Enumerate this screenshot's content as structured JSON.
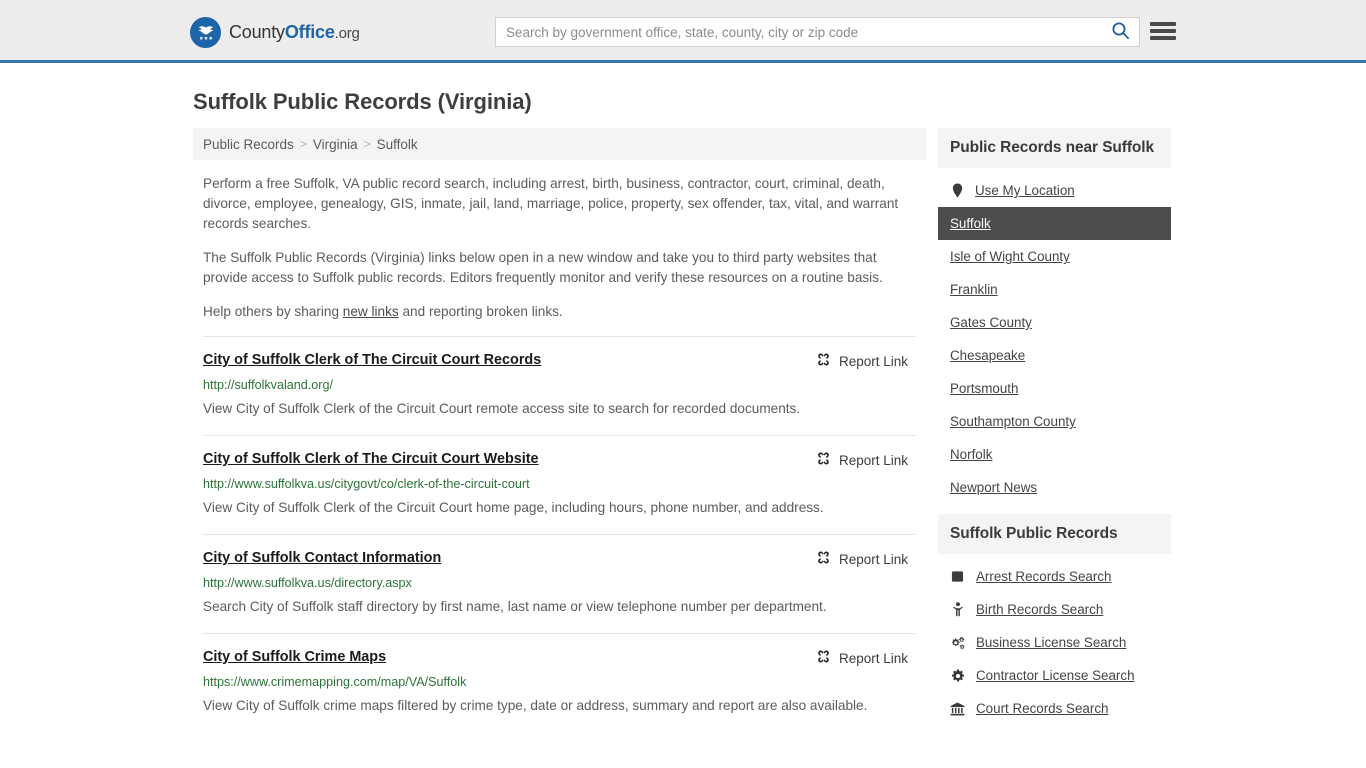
{
  "header": {
    "brand": {
      "part1": "County",
      "part2": "Office",
      "part3": ".org",
      "logo_icon": "eagle-shield-logo"
    },
    "search": {
      "placeholder": "Search by government office, state, county, city or zip code",
      "value": ""
    },
    "search_icon": "search-icon",
    "menu_icon": "hamburger-menu-icon"
  },
  "page": {
    "title": "Suffolk Public Records (Virginia)"
  },
  "breadcrumb": {
    "items": [
      {
        "label": "Public Records",
        "current": false
      },
      {
        "label": "Virginia",
        "current": false
      },
      {
        "label": "Suffolk",
        "current": true
      }
    ],
    "separator": ">"
  },
  "intro": {
    "p1": "Perform a free Suffolk, VA public record search, including arrest, birth, business, contractor, court, criminal, death, divorce, employee, genealogy, GIS, inmate, jail, land, marriage, police, property, sex offender, tax, vital, and warrant records searches.",
    "p2": "The Suffolk Public Records (Virginia) links below open in a new window and take you to third party websites that provide access to Suffolk public records. Editors frequently monitor and verify these resources on a routine basis.",
    "p3_before": "Help others by sharing ",
    "p3_link": "new links",
    "p3_after": " and reporting broken links."
  },
  "report_link_label": "Report Link",
  "report_link_icon": "broken-chain-icon",
  "results": [
    {
      "title": "City of Suffolk Clerk of The Circuit Court Records",
      "url": "http://suffolkvaland.org/",
      "description": "View City of Suffolk Clerk of the Circuit Court remote access site to search for recorded documents."
    },
    {
      "title": "City of Suffolk Clerk of The Circuit Court Website",
      "url": "http://www.suffolkva.us/citygovt/co/clerk-of-the-circuit-court",
      "description": "View City of Suffolk Clerk of the Circuit Court home page, including hours, phone number, and address."
    },
    {
      "title": "City of Suffolk Contact Information",
      "url": "http://www.suffolkva.us/directory.aspx",
      "description": "Search City of Suffolk staff directory by first name, last name or view telephone number per department."
    },
    {
      "title": "City of Suffolk Crime Maps",
      "url": "https://www.crimemapping.com/map/VA/Suffolk",
      "description": "View City of Suffolk crime maps filtered by crime type, date or address, summary and report are also available."
    }
  ],
  "aside": {
    "nearby": {
      "title": "Public Records near Suffolk",
      "items": [
        {
          "label": "Use My Location",
          "icon": "map-pin-icon",
          "active": false
        },
        {
          "label": "Suffolk",
          "icon": "",
          "active": true
        },
        {
          "label": "Isle of Wight County",
          "icon": "",
          "active": false
        },
        {
          "label": "Franklin",
          "icon": "",
          "active": false
        },
        {
          "label": "Gates County",
          "icon": "",
          "active": false
        },
        {
          "label": "Chesapeake",
          "icon": "",
          "active": false
        },
        {
          "label": "Portsmouth",
          "icon": "",
          "active": false
        },
        {
          "label": "Southampton County",
          "icon": "",
          "active": false
        },
        {
          "label": "Norfolk",
          "icon": "",
          "active": false
        },
        {
          "label": "Newport News",
          "icon": "",
          "active": false
        }
      ]
    },
    "records": {
      "title": "Suffolk Public Records",
      "items": [
        {
          "label": "Arrest Records Search",
          "icon": "square-icon"
        },
        {
          "label": "Birth Records Search",
          "icon": "baby-icon"
        },
        {
          "label": "Business License Search",
          "icon": "cogs-icon"
        },
        {
          "label": "Contractor License Search",
          "icon": "gear-icon"
        },
        {
          "label": "Court Records Search",
          "icon": "bank-icon"
        }
      ]
    }
  },
  "colors": {
    "header_bg": "#eeedec",
    "accent_blue": "#3a78ab",
    "brand_blue": "#1d64a8",
    "url_green": "#2c7337",
    "active_bg": "#4d4c4a",
    "panel_bg": "#f4f4f4"
  }
}
